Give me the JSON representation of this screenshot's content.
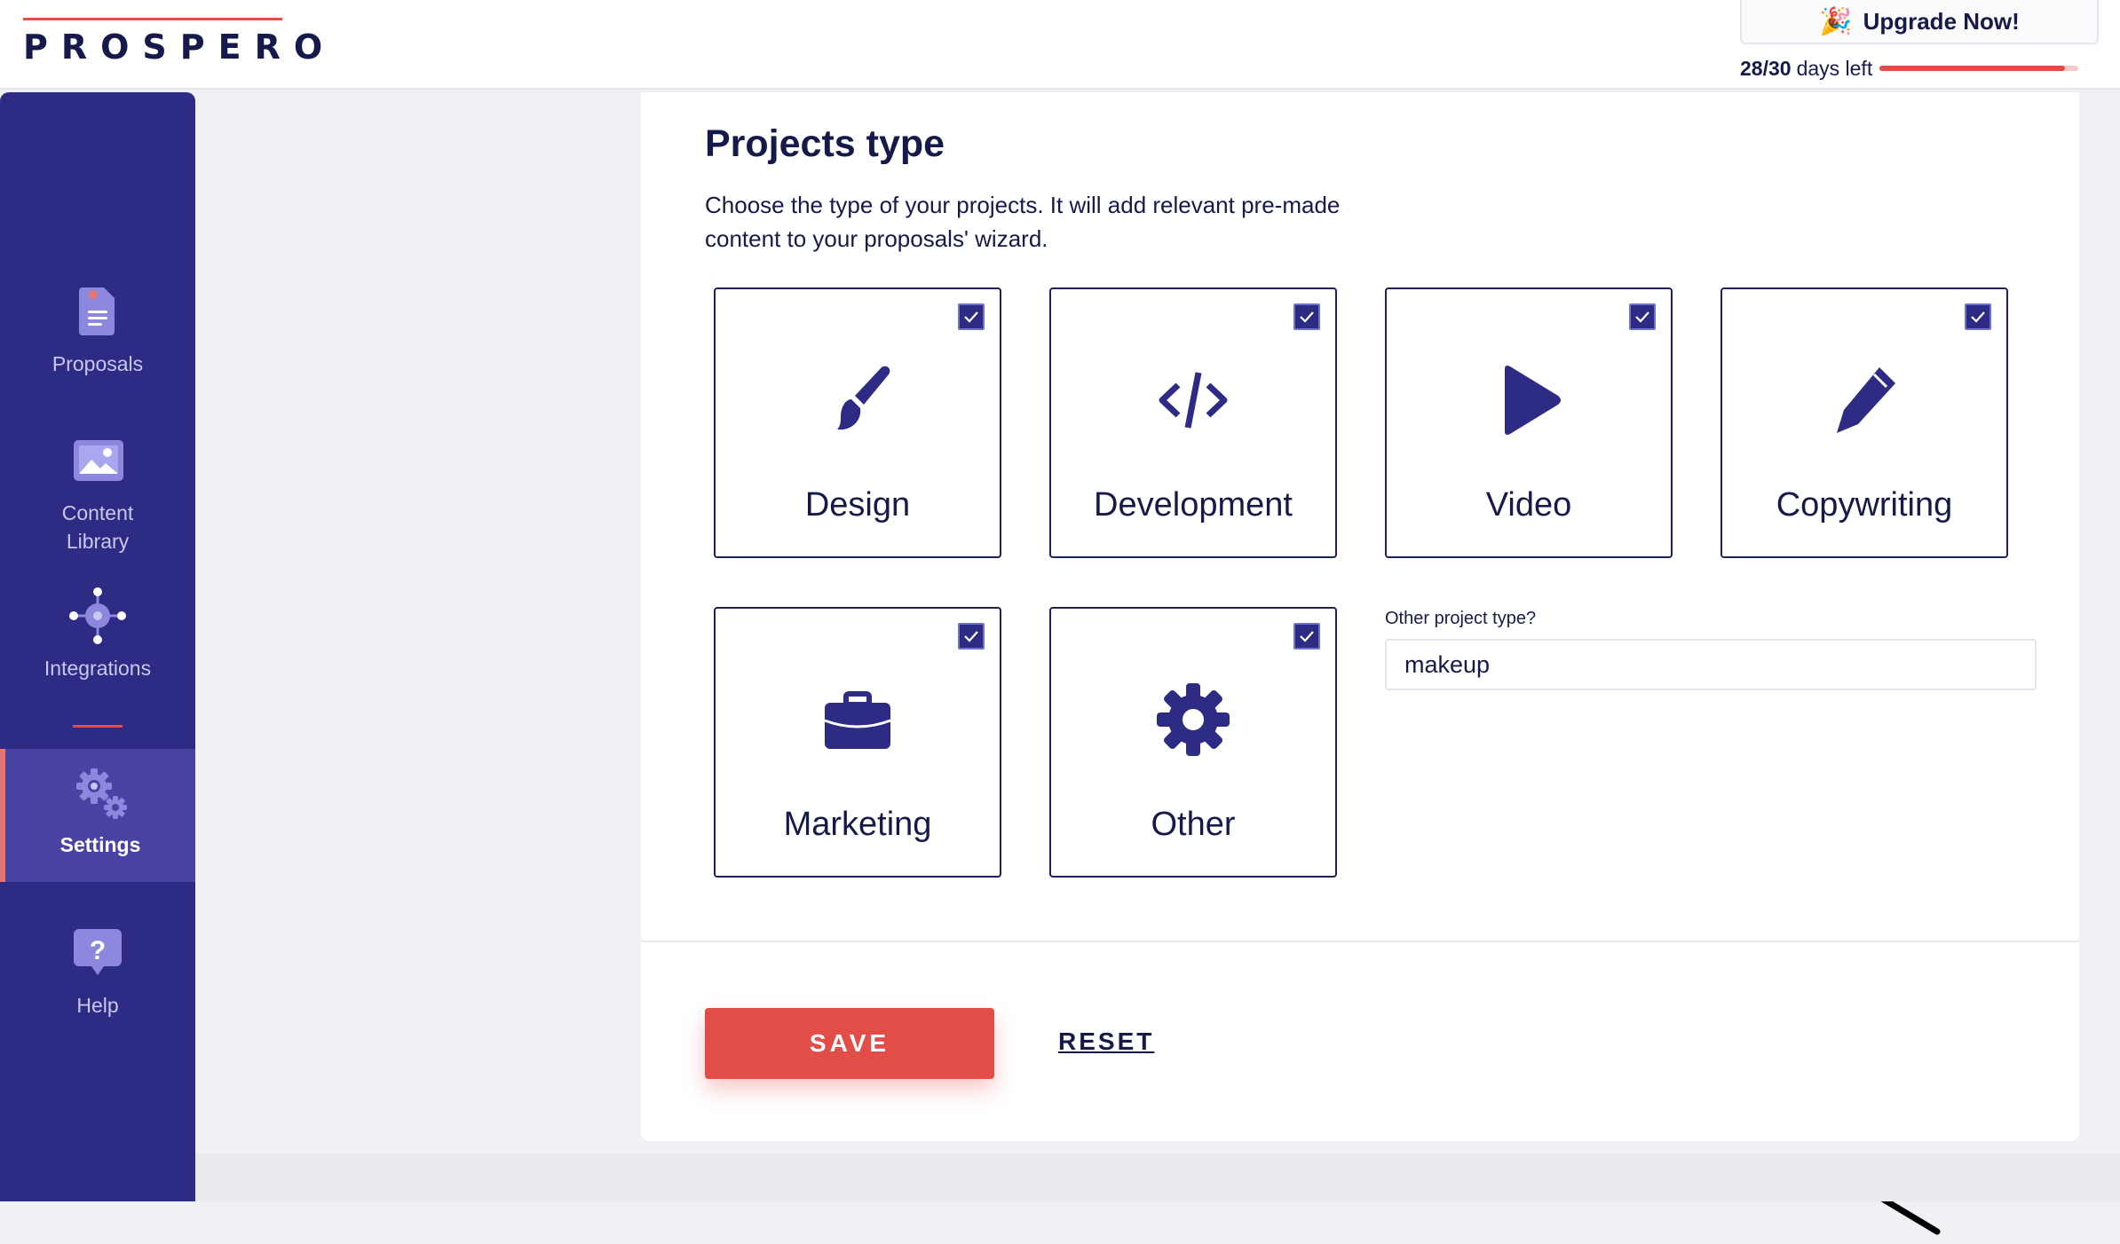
{
  "header": {
    "logo": "PROSPERO",
    "upgrade_label": "Upgrade Now!",
    "trial_count": "28/30",
    "trial_suffix": "days left",
    "trial_progress": 0.93
  },
  "sidebar": {
    "items": [
      {
        "label": "Proposals",
        "icon": "document-icon"
      },
      {
        "label": "Content Library",
        "icon": "image-icon"
      },
      {
        "label": "Integrations",
        "icon": "network-icon"
      },
      {
        "label": "Settings",
        "icon": "gear-icon",
        "active": true
      },
      {
        "label": "Help",
        "icon": "help-icon"
      }
    ]
  },
  "main": {
    "title": "Projects type",
    "description": "Choose the type of your projects. It will add relevant pre-made content to your proposals' wizard.",
    "cards": [
      {
        "label": "Design",
        "icon": "brush-icon",
        "checked": true
      },
      {
        "label": "Development",
        "icon": "code-icon",
        "checked": true
      },
      {
        "label": "Video",
        "icon": "play-icon",
        "checked": true
      },
      {
        "label": "Copywriting",
        "icon": "pen-icon",
        "checked": true
      },
      {
        "label": "Marketing",
        "icon": "briefcase-icon",
        "checked": true
      },
      {
        "label": "Other",
        "icon": "gear-icon",
        "checked": true
      }
    ],
    "other_label": "Other project type?",
    "other_value": "makeup",
    "save_label": "SAVE",
    "reset_label": "RESET"
  },
  "colors": {
    "brand_navy": "#2e2b85",
    "text_dark": "#161a4a",
    "accent_red": "#e24d48"
  }
}
